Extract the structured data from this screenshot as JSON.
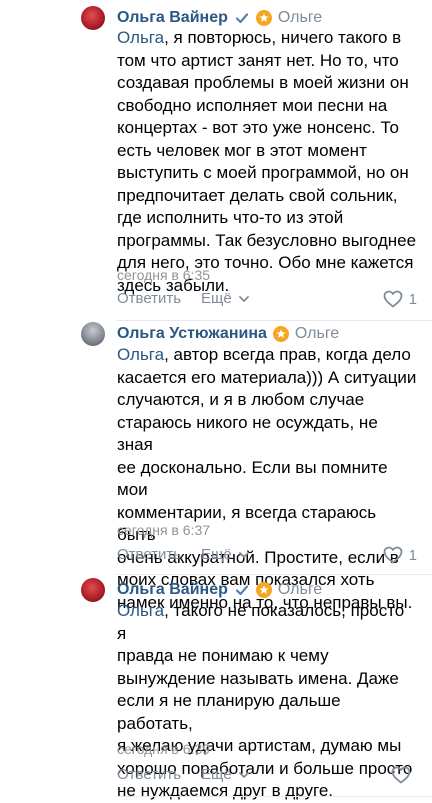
{
  "comments": [
    {
      "author": "Ольга Вайнер",
      "reply_to": "Ольге",
      "mention": "Ольга",
      "text_lines": [
        ", я повторюсь, ничего такого в",
        "том что артист занят нет. Но то, что",
        "создавая проблемы в моей жизни он",
        "свободно исполняет мои песни на",
        "концертах - вот это уже нонсенс. То",
        "есть человек мог в этот момент",
        "выступить с моей программой, но он",
        "предпочитает делать свой сольник,",
        "где исполнить что-то из этой",
        "программы. Так безусловно выгоднее",
        "для него, это точно. Обо мне кажется",
        "здесь забыли."
      ],
      "time": "сегодня в 6:35",
      "reply_label": "Ответить",
      "more_label": "Ещё",
      "likes": "1"
    },
    {
      "author": "Ольга Устюжанина",
      "reply_to": "Ольге",
      "mention": "Ольга",
      "text_lines": [
        ", автор всегда прав, когда дело",
        "касается его материала))) А ситуации",
        "случаются, и я в любом случае",
        "стараюсь никого не осуждать, не зная",
        "ее досконально. Если вы помните мои",
        "комментарии, я всегда стараюсь быть",
        "очень аккуратной. Простите, если в",
        "моих словах вам показался хоть",
        "намек именно на то, что неправы вы."
      ],
      "time": "сегодня в 6:37",
      "reply_label": "Ответить",
      "more_label": "Ещё",
      "likes": "1"
    },
    {
      "author": "Ольга Вайнер",
      "reply_to": "Ольге",
      "mention": "Ольга",
      "text_lines": [
        ", такого не показалось, просто я",
        "правда не понимаю к чему",
        "вынуждение называть имена. Даже",
        "если я не планирую дальше работать,",
        "я желаю удачи артистам, думаю мы",
        "хорошо поработали и больше просто",
        "не нуждаемся друг в друге."
      ],
      "time": "сегодня в 6:39",
      "reply_label": "Ответить",
      "more_label": "Ещё",
      "likes": ""
    }
  ],
  "colors": {
    "link": "#2a5885",
    "secondary": "#818c99",
    "verified": "#5181b8",
    "star": "#f5a623"
  }
}
